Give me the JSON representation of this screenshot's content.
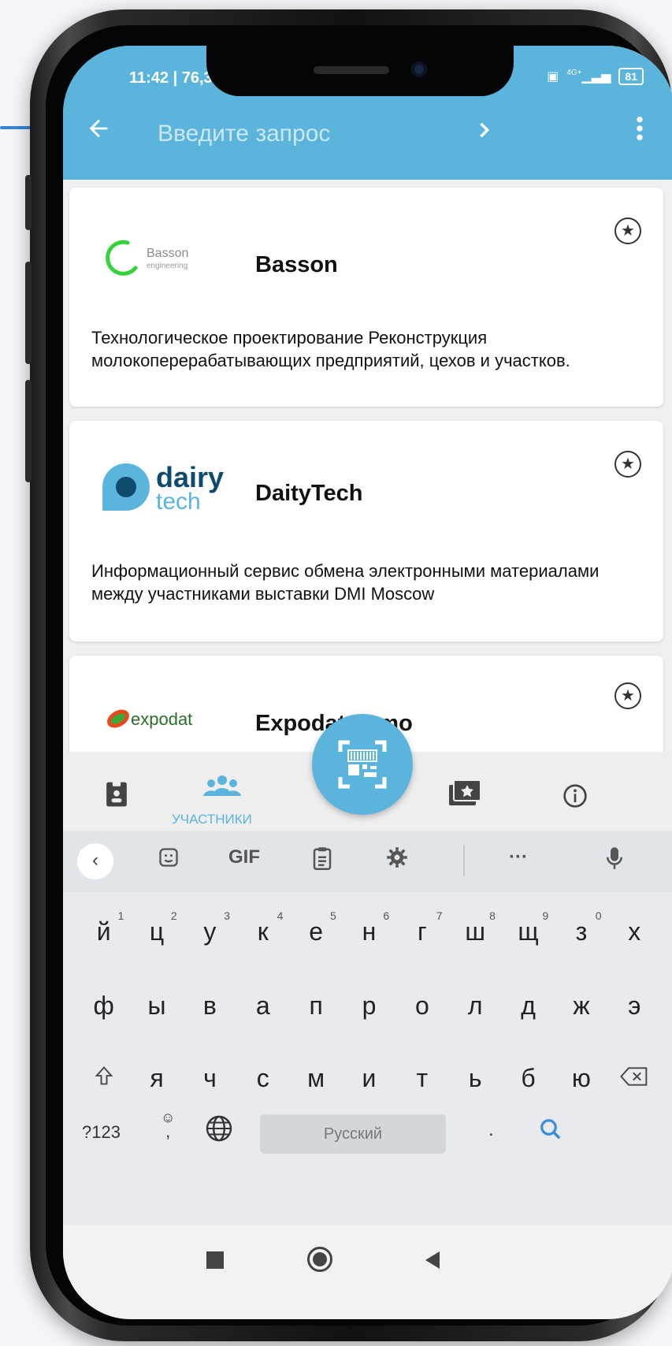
{
  "status_bar": {
    "time": "11:42 | 76,3",
    "network": "4G+",
    "battery": "81"
  },
  "toolbar": {
    "back_icon": "arrow-left-icon",
    "search_placeholder": "Введите запрос",
    "next_icon": "chevron-right-icon",
    "menu_icon": "more-vertical-icon"
  },
  "exhibitors": [
    {
      "name": "Basson",
      "logo_text": "Basson",
      "logo_subtext": "engineering",
      "description": "Технологическое проектирование Реконструкция молокоперерабатывающих предприятий, цехов и участков."
    },
    {
      "name": "DaityTech",
      "logo_text": "dairy",
      "logo_subtext": "tech",
      "description": "Информационный сервис обмена электронными материалами между участниками выставки DMI Moscow"
    },
    {
      "name": "Expodat demo",
      "logo_text": "expodat",
      "description": ""
    }
  ],
  "bottom_nav": {
    "participants_label": "УЧАСТНИКИ",
    "items": [
      "badge-icon",
      "participants-icon",
      "qr-scan-icon",
      "folder-star-icon",
      "info-icon"
    ]
  },
  "keyboard": {
    "toolbar": {
      "gif_label": "GIF",
      "more_label": "···"
    },
    "row1": [
      "й",
      "ц",
      "у",
      "к",
      "е",
      "н",
      "г",
      "ш",
      "щ",
      "з",
      "х"
    ],
    "row1_hints": [
      "1",
      "2",
      "3",
      "4",
      "5",
      "6",
      "7",
      "8",
      "9",
      "0",
      ""
    ],
    "row2": [
      "ф",
      "ы",
      "в",
      "а",
      "п",
      "р",
      "о",
      "л",
      "д",
      "ж",
      "э"
    ],
    "row3": [
      "я",
      "ч",
      "с",
      "м",
      "и",
      "т",
      "ь",
      "б",
      "ю"
    ],
    "symbols_label": "?123",
    "comma_label": ",",
    "space_label": "Русский",
    "period_label": "."
  },
  "colors": {
    "accent": "#5bb4dc",
    "pointer": "#3a84d6"
  }
}
